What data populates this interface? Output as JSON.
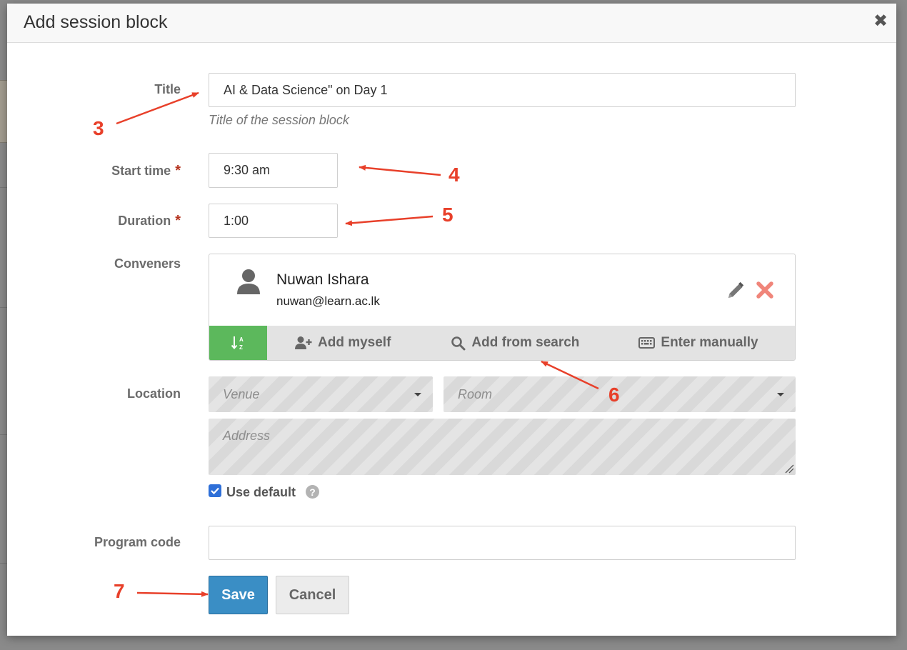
{
  "dialog": {
    "title": "Add session block",
    "close_symbol": "✖"
  },
  "form": {
    "title": {
      "label": "Title",
      "value": "AI & Data Science\" on Day 1",
      "hint": "Title of the session block"
    },
    "start_time": {
      "label": "Start time",
      "required_mark": "*",
      "value": "9:30 am"
    },
    "duration": {
      "label": "Duration",
      "required_mark": "*",
      "value": "1:00"
    },
    "conveners": {
      "label": "Conveners",
      "person": {
        "name": "Nuwan Ishara",
        "email": "nuwan@learn.ac.lk"
      },
      "icons": {
        "person": "user-icon",
        "edit": "pencil-icon",
        "remove": "close-x-icon",
        "sort": "sort-alpha-icon"
      },
      "toolbar": {
        "add_myself": "Add myself",
        "add_from_search": "Add from search",
        "enter_manually": "Enter manually"
      }
    },
    "location": {
      "label": "Location",
      "venue_placeholder": "Venue",
      "room_placeholder": "Room",
      "address_placeholder": "Address",
      "use_default_label": "Use default",
      "use_default_checked": true,
      "help_symbol": "?"
    },
    "program_code": {
      "label": "Program code",
      "value": ""
    }
  },
  "actions": {
    "save": "Save",
    "cancel": "Cancel"
  },
  "annotations": {
    "callouts": [
      "3",
      "4",
      "5",
      "6",
      "7"
    ],
    "color": "#e8402a"
  },
  "colors": {
    "save_button": "#3a8ec5",
    "sort_button": "#5cb85c",
    "required": "#b5341f",
    "remove_icon": "#f0857a"
  }
}
